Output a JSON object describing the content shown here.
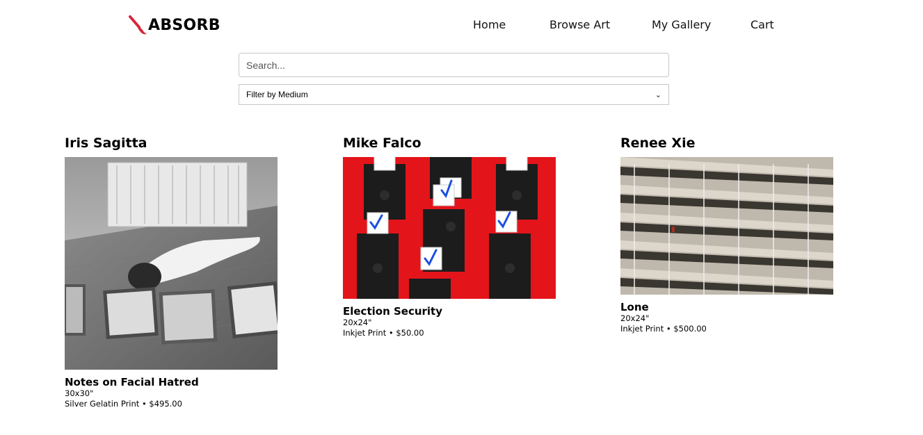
{
  "brand": {
    "name": "ABSORB",
    "icon": "paintbrush-icon",
    "icon_color": "#d7263d"
  },
  "nav": {
    "items": [
      "Home",
      "Browse Art",
      "My Gallery",
      "Cart"
    ]
  },
  "search": {
    "placeholder": "Search..."
  },
  "filter": {
    "selected": "Filter by Medium"
  },
  "artworks": [
    {
      "artist": "Iris Sagitta",
      "title": "Notes on Facial Hatred",
      "size": "30x30\"",
      "meta": "Silver Gelatin Print • $495.00"
    },
    {
      "artist": "Mike Falco",
      "title": "Election Security",
      "size": "20x24\"",
      "meta": "Inkjet Print • $50.00"
    },
    {
      "artist": "Renee Xie",
      "title": "Lone",
      "size": "20x24\"",
      "meta": "Inkjet Print • $500.00"
    }
  ]
}
